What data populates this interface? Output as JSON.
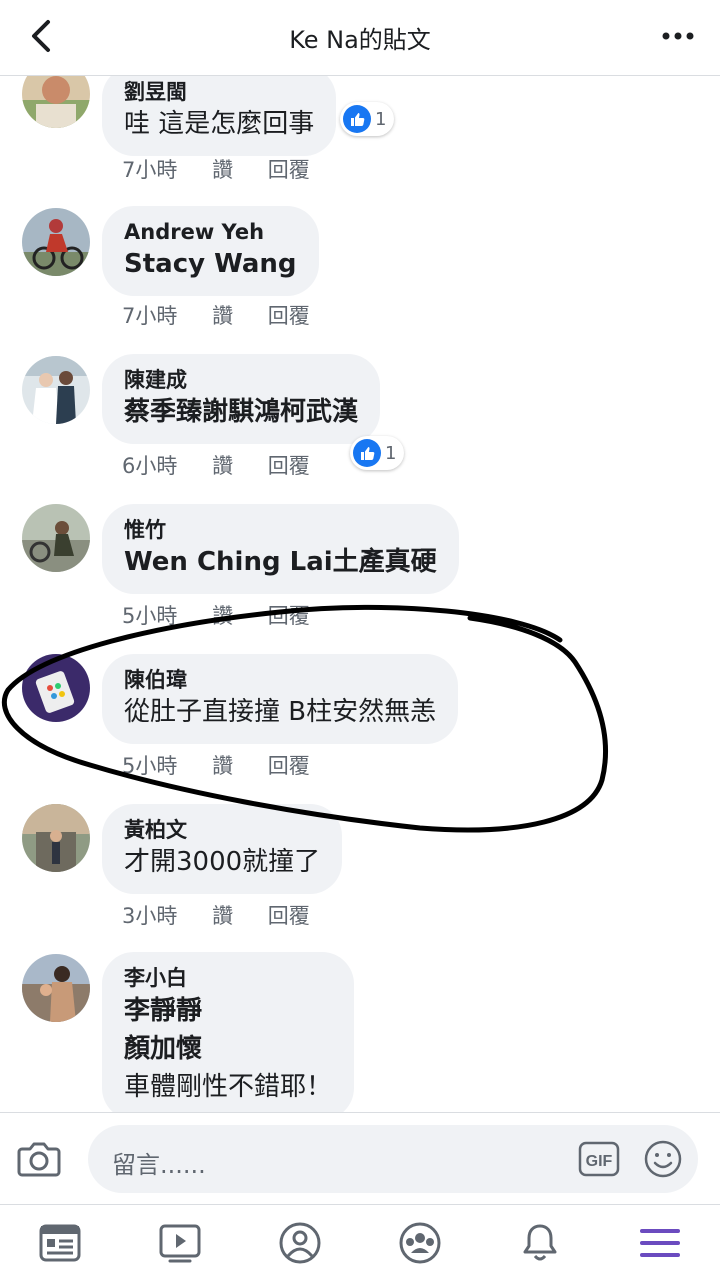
{
  "header": {
    "title": "Ke Na的貼文"
  },
  "comments": [
    {
      "author": "劉昱閩",
      "text": "哇 這是怎麼回事",
      "time": "7小時",
      "like_label": "讚",
      "reply_label": "回覆",
      "reactions": "1"
    },
    {
      "author": "Andrew Yeh",
      "text": "Stacy Wang",
      "time": "7小時",
      "like_label": "讚",
      "reply_label": "回覆"
    },
    {
      "author": "陳建成",
      "text": "蔡季臻謝騏鴻柯武漢",
      "time": "6小時",
      "like_label": "讚",
      "reply_label": "回覆",
      "reactions": "1"
    },
    {
      "author": "惟竹",
      "text": "Wen Ching Lai土產真硬",
      "time": "5小時",
      "like_label": "讚",
      "reply_label": "回覆"
    },
    {
      "author": "陳伯瑋",
      "text": "從肚子直接撞 B柱安然無恙",
      "time": "5小時",
      "like_label": "讚",
      "reply_label": "回覆"
    },
    {
      "author": "黃柏文",
      "text": "才開3000就撞了",
      "time": "3小時",
      "like_label": "讚",
      "reply_label": "回覆"
    },
    {
      "author": "李小白",
      "lines": [
        "李靜靜",
        "顏加懷",
        "車體剛性不錯耶！"
      ]
    }
  ],
  "composer": {
    "placeholder": "留言......",
    "gif_label": "GIF"
  },
  "colors": {
    "accent": "#1877f2",
    "menu_active": "#6b4bbf",
    "bubble": "#f0f2f5"
  }
}
